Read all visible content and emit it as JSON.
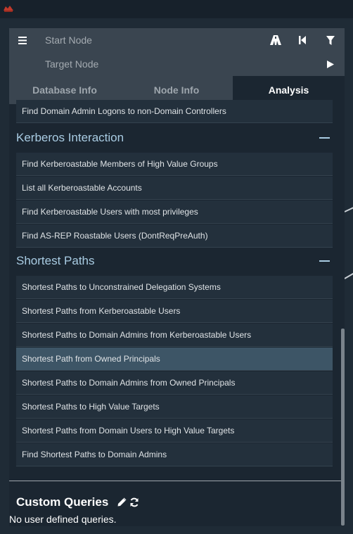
{
  "search": {
    "start_placeholder": "Start Node",
    "target_placeholder": "Target Node"
  },
  "tabs": [
    {
      "label": "Database Info",
      "active": false
    },
    {
      "label": "Node Info",
      "active": false
    },
    {
      "label": "Analysis",
      "active": true
    }
  ],
  "analysis": {
    "partial_item": "Find Domain Admin Logons to non-Domain Controllers",
    "kerberos": {
      "title": "Kerberos Interaction",
      "items": [
        "Find Kerberoastable Members of High Value Groups",
        "List all Kerberoastable Accounts",
        "Find Kerberoastable Users with most privileges",
        "Find AS-REP Roastable Users (DontReqPreAuth)"
      ]
    },
    "shortest": {
      "title": "Shortest Paths",
      "items": [
        "Shortest Paths to Unconstrained Delegation Systems",
        "Shortest Paths from Kerberoastable Users",
        "Shortest Paths to Domain Admins from Kerberoastable Users",
        "Shortest Path from Owned Principals",
        "Shortest Paths to Domain Admins from Owned Principals",
        "Shortest Paths to High Value Targets",
        "Shortest Paths from Domain Users to High Value Targets",
        "Find Shortest Paths to Domain Admins"
      ],
      "selected_item": "Shortest Path from Owned Principals"
    }
  },
  "custom_queries": {
    "title": "Custom Queries",
    "empty_text": "No user defined queries."
  },
  "icons": {
    "menu": "menu-icon",
    "pathfinding": "pathfinding-icon",
    "back": "back-icon",
    "filter": "filter-icon",
    "play": "play-icon",
    "edit": "edit-icon",
    "refresh": "refresh-icon",
    "collapse": "collapse-icon"
  },
  "colors": {
    "accent": "#a9cce3",
    "selected": "#3d5566"
  }
}
